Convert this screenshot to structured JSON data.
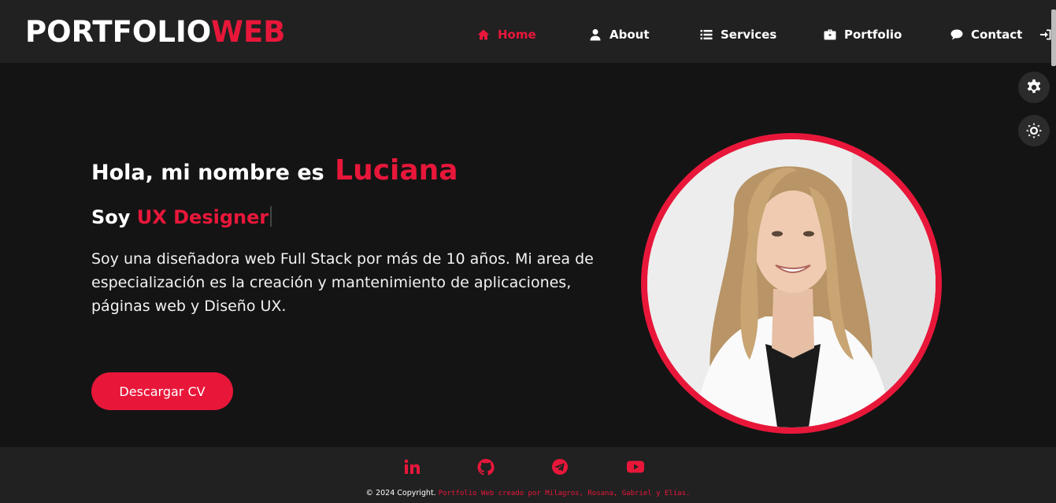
{
  "logo": {
    "part1": "PORTFOLIO",
    "part2": "WEB"
  },
  "nav": {
    "items": [
      {
        "label": "Home",
        "icon": "home-icon",
        "active": true
      },
      {
        "label": "About",
        "icon": "user-icon",
        "active": false
      },
      {
        "label": "Services",
        "icon": "list-icon",
        "active": false
      },
      {
        "label": "Portfolio",
        "icon": "briefcase-icon",
        "active": false
      },
      {
        "label": "Contact",
        "icon": "chat-icon",
        "active": false
      }
    ],
    "login_icon": "login-icon"
  },
  "side_buttons": [
    {
      "icon": "gear-icon"
    },
    {
      "icon": "sun-icon"
    }
  ],
  "hero": {
    "greeting": "Hola, mi nombre es",
    "name": "Luciana",
    "role_prefix": "Soy",
    "role": "UX Designer",
    "bio": "Soy una diseñadora web Full Stack por más de 10 años. Mi area de especialización es la creación y mantenimiento de aplicaciones, páginas web y Diseño UX.",
    "cv_button": "Descargar CV"
  },
  "footer": {
    "social": [
      "linkedin-icon",
      "github-icon",
      "telegram-icon",
      "youtube-icon"
    ],
    "copyright": "© 2024 Copyright.",
    "credit": "Portfolio Web creado por Milagros, Rosana, Gabriel y Elías."
  },
  "colors": {
    "accent": "#e8173a",
    "header_bg": "#212121",
    "body_bg": "#141414"
  }
}
